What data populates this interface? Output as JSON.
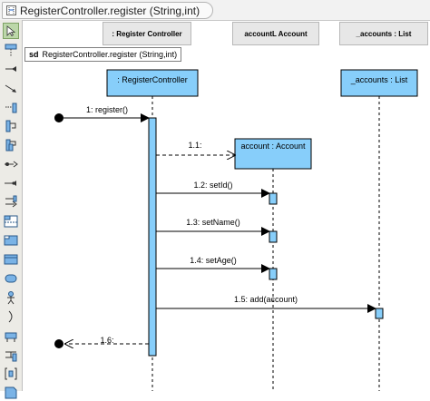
{
  "breadcrumb": {
    "title": "RegisterController.register (String,int)",
    "icon": "sequence-diagram-icon"
  },
  "toolbar": {
    "tools": [
      "pointer-icon",
      "lifeline-icon",
      "message-icon",
      "duplicate-message-icon",
      "self-message-icon",
      "recursive-message-icon",
      "reentrant-message-icon",
      "create-message-icon",
      "found-message-icon",
      "lost-message-icon",
      "combined-fragment-icon",
      "interaction-use-icon",
      "frame-icon",
      "continuation-icon",
      "actor-icon",
      "gate-icon",
      "state-invariant-icon",
      "duration-icon",
      "interaction-icon",
      "note-icon"
    ]
  },
  "lane_headers": [
    ": Register Controller",
    "accountL Account",
    "_accounts : List"
  ],
  "frame": {
    "keyword": "sd",
    "name": "RegisterController.register (String,int)"
  },
  "lifelines": [
    ": RegisterController",
    "account : Account",
    "_accounts : List"
  ],
  "messages": [
    "1: register()",
    "1.1:",
    "1.2: setId()",
    "1.3: setName()",
    "1.4: setAge()",
    "1.5: add(account)",
    "1.6:"
  ],
  "colors": {
    "lifeline_fill": "#87cefa",
    "selected_tool": "#bcd7a9"
  }
}
